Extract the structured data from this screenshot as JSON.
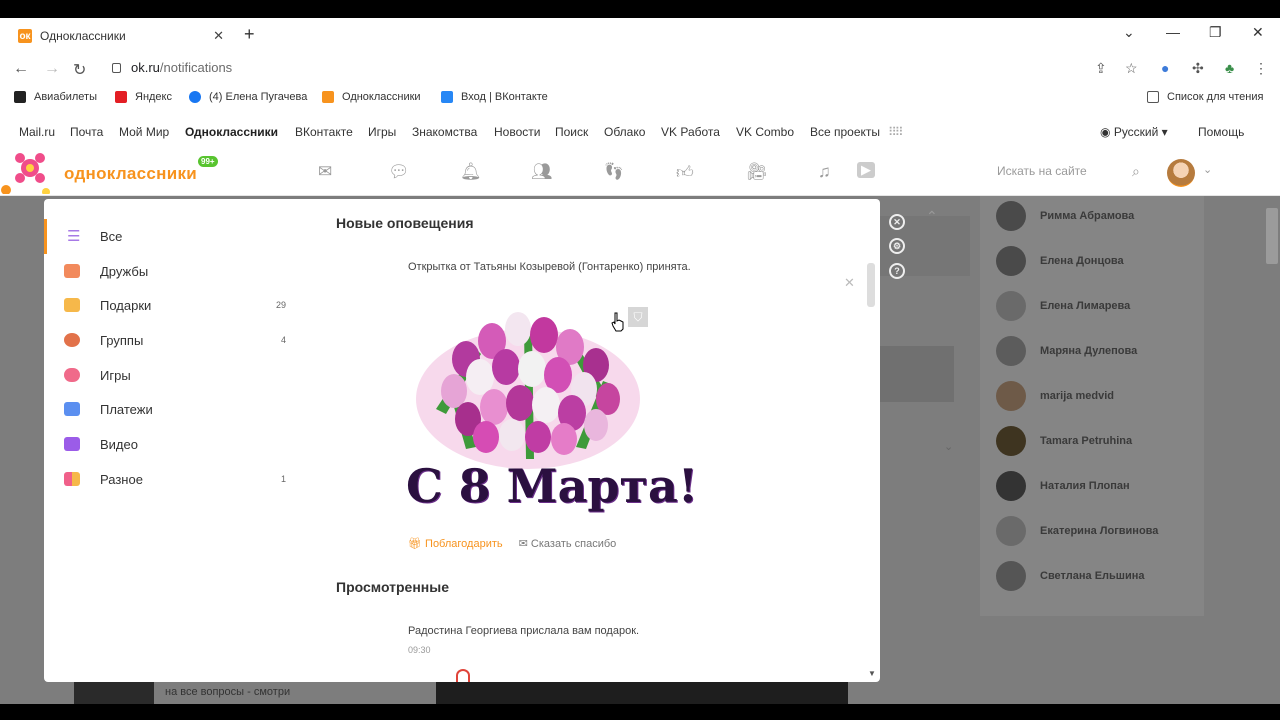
{
  "browser": {
    "tab_title": "Одноклассники",
    "new_tab": "+",
    "url_domain": "ok.ru",
    "url_path": "/notifications",
    "bookmarks": [
      "Авиабилеты",
      "Яндекс",
      "(4) Елена Пугачева",
      "Одноклассники",
      "Вход | ВКонтакте"
    ],
    "reading_list": "Список для чтения"
  },
  "portal": {
    "links": [
      "Mail.ru",
      "Почта",
      "Мой Мир",
      "Одноклассники",
      "ВКонтакте",
      "Игры",
      "Знакомства",
      "Новости",
      "Поиск",
      "Облако",
      "VK Работа",
      "VK Combo",
      "Все проекты"
    ],
    "language": "Русский",
    "help": "Помощь"
  },
  "header": {
    "logo_text": "одноклассники",
    "badge": "99+",
    "search_placeholder": "Искать на сайте"
  },
  "menu": {
    "items": [
      {
        "label": "Все",
        "count": "",
        "color": "#a779e6"
      },
      {
        "label": "Дружбы",
        "count": "",
        "color": "#f28a5c"
      },
      {
        "label": "Подарки",
        "count": "29",
        "color": "#f6b84a"
      },
      {
        "label": "Группы",
        "count": "4",
        "color": "#e2724a"
      },
      {
        "label": "Игры",
        "count": "",
        "color": "#f06a8a"
      },
      {
        "label": "Платежи",
        "count": "",
        "color": "#5b8ff0"
      },
      {
        "label": "Видео",
        "count": "",
        "color": "#9b5ce8"
      },
      {
        "label": "Разное",
        "count": "1",
        "color": "#f0608a"
      }
    ]
  },
  "notifications": {
    "new_title": "Новые оповещения",
    "postcard_text": "Открытка от Татьяны Козыревой (Гонтаренко) принята.",
    "card_caption": "С 8 Марта!",
    "thank_button": "Поблагодарить",
    "say_thanks_button": "Сказать спасибо",
    "viewed_title": "Просмотренные",
    "viewed_text": "Радостина Георгиева прислала вам подарок.",
    "viewed_time": "09:30"
  },
  "friends": [
    "Римма Абрамова",
    "Елена Донцова",
    "Елена Лимарева",
    "Маряна Дулепова",
    "marija medvid",
    "Tamara Petruhina",
    "Наталия Плопан",
    "Екатерина Логвинова",
    "Светлана Ельшина"
  ],
  "background": {
    "bottom_text": "на все вопросы - смотри"
  },
  "colors": {
    "accent": "#f7931e",
    "overlay": "#7d7d7d"
  }
}
